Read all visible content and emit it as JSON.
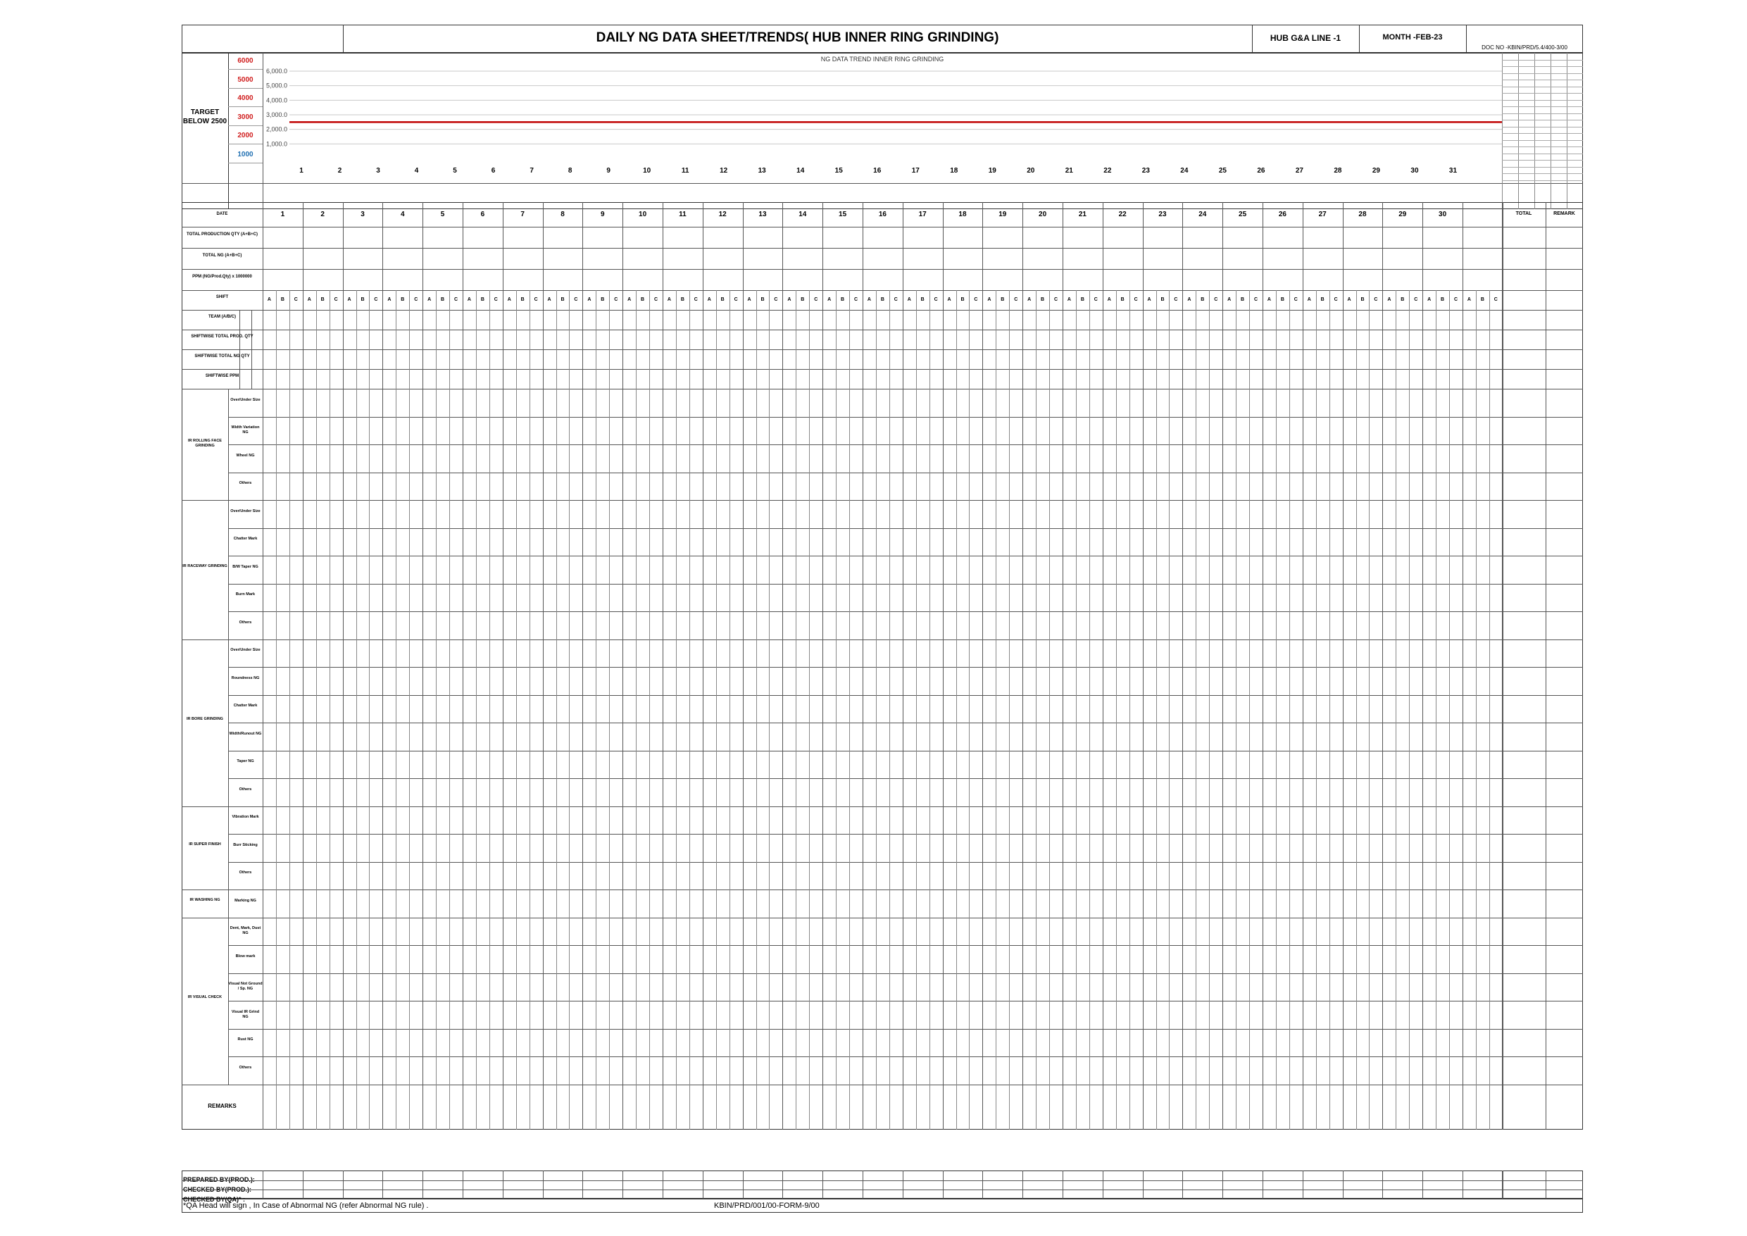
{
  "header": {
    "title": "DAILY NG DATA SHEET/TRENDS( HUB INNER RING GRINDING)",
    "line": "HUB G&A LINE -1",
    "month": "MONTH -FEB-23",
    "doc_no": "DOC NO -KBIN/PRD/5.4/400-3/00"
  },
  "target": {
    "label": "TARGET BELOW 2500",
    "value": 2500,
    "color": "#1f6fb2"
  },
  "scale_labels": [
    {
      "text": "6000",
      "color": "#d01c1c"
    },
    {
      "text": "5000",
      "color": "#d01c1c"
    },
    {
      "text": "4000",
      "color": "#d01c1c"
    },
    {
      "text": "3000",
      "color": "#d01c1c"
    },
    {
      "text": "2000",
      "color": "#d01c1c"
    },
    {
      "text": "1000",
      "color": "#1f6fb2"
    }
  ],
  "chart_data": {
    "type": "line",
    "title": "NG DATA TREND INNER RING GRINDING",
    "x": [
      1,
      2,
      3,
      4,
      5,
      6,
      7,
      8,
      9,
      10,
      11,
      12,
      13,
      14,
      15,
      16,
      17,
      18,
      19,
      20,
      21,
      22,
      23,
      24,
      25,
      26,
      27,
      28,
      29,
      30,
      31
    ],
    "y_ticks": [
      "6,000.0",
      "5,000.0",
      "4,000.0",
      "3,000.0",
      "2,000.0",
      "1,000.0"
    ],
    "ylim": [
      0,
      6000
    ],
    "series": [],
    "reference_line": {
      "value": 2500,
      "color": "#c00000"
    },
    "grid": true,
    "line_color": "#c00000"
  },
  "table": {
    "date_label": "DATE",
    "total_label": "TOTAL",
    "remark_label": "REMARK",
    "days": [
      "1",
      "2",
      "3",
      "4",
      "5",
      "6",
      "7",
      "8",
      "9",
      "10",
      "11",
      "12",
      "13",
      "14",
      "15",
      "16",
      "17",
      "18",
      "19",
      "20",
      "21",
      "22",
      "23",
      "24",
      "25",
      "26",
      "27",
      "28",
      "29",
      "30"
    ],
    "shift_letters": [
      "A",
      "B",
      "C"
    ],
    "top_rows": [
      {
        "label": "TOTAL PRODUCTION QTY (A+B+C)"
      },
      {
        "label": "TOTAL NG (A+B+C)"
      },
      {
        "label": "PPM (NG/Prod.Qty) x 1000000"
      }
    ],
    "shift_label": "SHIFT",
    "shift_rows": [
      {
        "label": "TEAM (A/B/C)"
      },
      {
        "label": "SHIFTWISE TOTAL PROD. QTY"
      },
      {
        "label": "SHIFTWISE TOTAL NG QTY"
      },
      {
        "label": "SHIFTWISE PPM"
      }
    ],
    "groups": [
      {
        "label": "IR ROLLING FACE GRINDING",
        "items": [
          "Over/Under Size",
          "Width Variation NG",
          "Wheel NG",
          "Others"
        ]
      },
      {
        "label": "IR RACEWAY GRINDING",
        "items": [
          "Over/Under Size",
          "Chatter Mark",
          "B/W Taper NG",
          "Burn Mark",
          "Others"
        ]
      },
      {
        "label": "IR BORE GRINDING",
        "items": [
          "Over/Under Size",
          "Roundness NG",
          "Chatter Mark",
          "Width/Runout NG",
          "Taper NG",
          "Others"
        ]
      },
      {
        "label": "IR SUPER FINISH",
        "items": [
          "Vibration Mark",
          "Burr Sticking",
          "Others"
        ]
      },
      {
        "label": "IR WASHING NG",
        "items": [
          "Marking NG"
        ]
      },
      {
        "label": "IR VISUAL CHECK",
        "items": [
          "Dent, Mark, Dust NG",
          "Blow mark",
          "Visual Not Ground / Sp. NG",
          "Visual IR Grind NG",
          "Rust NG",
          "Others"
        ]
      }
    ],
    "remarks_label": "REMARKS"
  },
  "footer": {
    "prepared": "PREPARED BY(PROD.):",
    "checked1": "CHECKED BY(PROD.):",
    "checked2": "CHECKED BY(QA)* :",
    "note": "*QA Head will sign , In Case of Abnormal NG (refer Abnormal NG rule) .",
    "form_no": "KBIN/PRD/001/00-FORM-9/00"
  }
}
